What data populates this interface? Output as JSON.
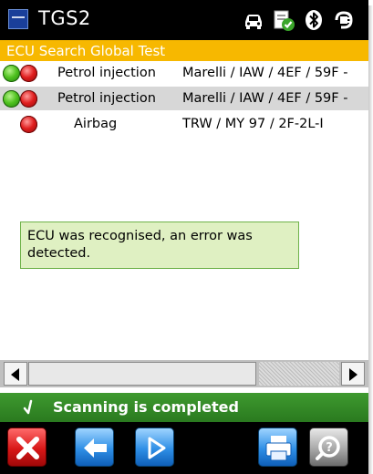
{
  "titlebar": {
    "app_title": "TGS2",
    "icons": [
      "app-logo-icon",
      "car-icon",
      "document-check-icon",
      "bluetooth-icon",
      "power-plug-icon"
    ]
  },
  "header": {
    "title": "ECU Search Global Test"
  },
  "ecu_list": {
    "rows": [
      {
        "indicators": [
          "green",
          "red"
        ],
        "name": "Petrol injection",
        "version": "Marelli / IAW / 4EF / 59F -",
        "selected": false
      },
      {
        "indicators": [
          "green",
          "red"
        ],
        "name": "Petrol injection",
        "version": "Marelli / IAW / 4EF / 59F -",
        "selected": true
      },
      {
        "indicators": [
          "red"
        ],
        "name": "Airbag",
        "version": "TRW / MY 97 / 2F-2L-I",
        "selected": false
      }
    ]
  },
  "tooltip": {
    "text": "ECU was recognised, an error was detected."
  },
  "status": {
    "icon": "checkmark-icon",
    "text": "Scanning is completed"
  },
  "toolbar": {
    "buttons": [
      "close-icon",
      "back-arrow-icon",
      "play-icon",
      "print-icon",
      "help-magnifier-icon"
    ]
  },
  "colors": {
    "header_bg": "#f7b800",
    "status_bg": "#2e8a22",
    "tooltip_bg": "#dff0c2",
    "selected_row": "#d7d7d7"
  }
}
